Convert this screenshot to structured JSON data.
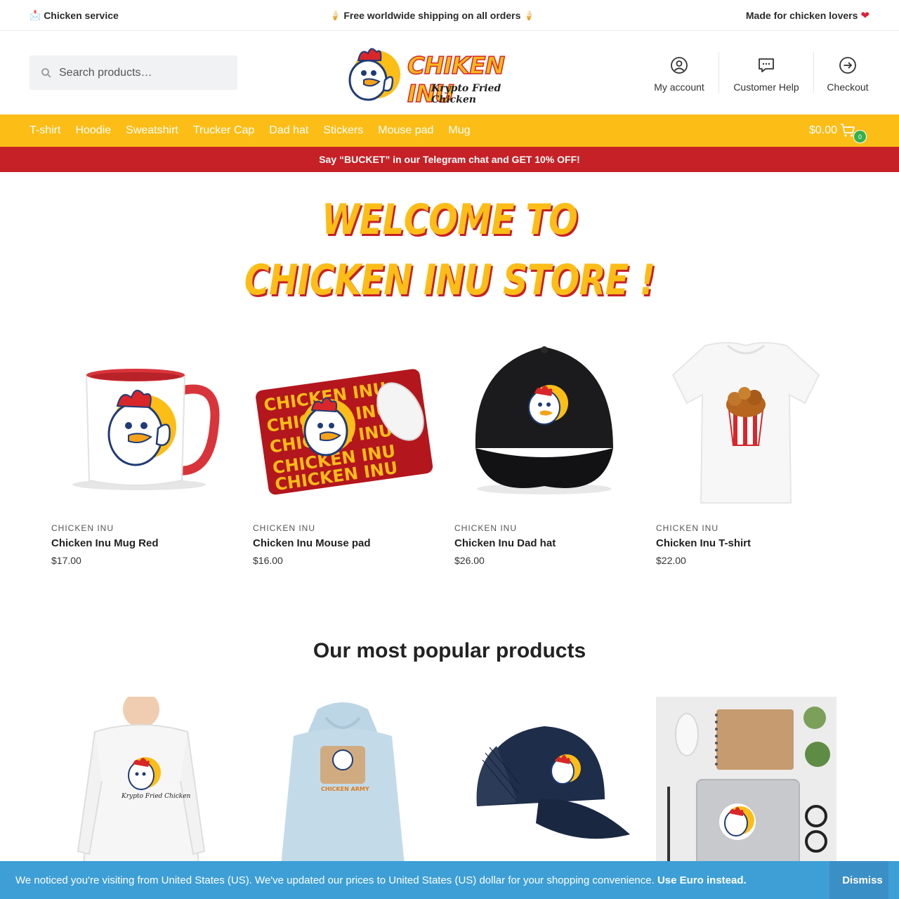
{
  "topbar": {
    "left_icon": "📩",
    "left_text": "Chicken service",
    "center_icon": "🍦",
    "center_text": "Free worldwide shipping on all orders",
    "right_text": "Made for chicken lovers",
    "right_icon": "heart-icon"
  },
  "header": {
    "search_placeholder": "Search products…",
    "logo_title": "CHIKEN INU",
    "logo_subtitle": "Krypto Fried Chicken",
    "actions": {
      "account": "My account",
      "help": "Customer Help",
      "checkout": "Checkout"
    }
  },
  "nav": {
    "items": [
      "T-shirt",
      "Hoodie",
      "Sweatshirt",
      "Trucker Cap",
      "Dad hat",
      "Stickers",
      "Mouse pad",
      "Mug"
    ],
    "cart_total": "$0.00",
    "cart_count": "0"
  },
  "promo": {
    "text": "Say “BUCKET” in our Telegram chat and GET 10% OFF!"
  },
  "hero": {
    "line1": "Welcome to",
    "line2": "Chicken Inu Store !"
  },
  "featured": [
    {
      "brand": "CHICKEN INU",
      "title": "Chicken Inu Mug Red",
      "price": "$17.00",
      "image": "mug-image"
    },
    {
      "brand": "CHICKEN INU",
      "title": "Chicken Inu Mouse pad",
      "price": "$16.00",
      "image": "mousepad-image"
    },
    {
      "brand": "CHICKEN INU",
      "title": "Chicken Inu Dad hat",
      "price": "$26.00",
      "image": "dadhat-image"
    },
    {
      "brand": "CHICKEN INU",
      "title": "Chicken Inu T-shirt",
      "price": "$22.00",
      "image": "tshirt-image"
    }
  ],
  "popular": {
    "title": "Our most popular products",
    "mousepad_text": "CHICKEN INU",
    "sweatshirt_text": "Krypto Fried Chicken",
    "hoodie_text": "CHICKEN ARMY",
    "items": [
      {
        "image": "sweatshirt-image"
      },
      {
        "image": "hoodie-image"
      },
      {
        "image": "trucker-cap-image"
      },
      {
        "image": "stickers-image"
      }
    ]
  },
  "notice": {
    "message": "We noticed you're visiting from United States (US). We've updated our prices to United States (US) dollar for your shopping convenience.",
    "link": "Use Euro instead.",
    "dismiss": "Dismiss"
  },
  "colors": {
    "yellow": "#fcbd17",
    "red": "#c62127",
    "blue": "#3d9fd6",
    "green_badge": "#35b04a"
  }
}
